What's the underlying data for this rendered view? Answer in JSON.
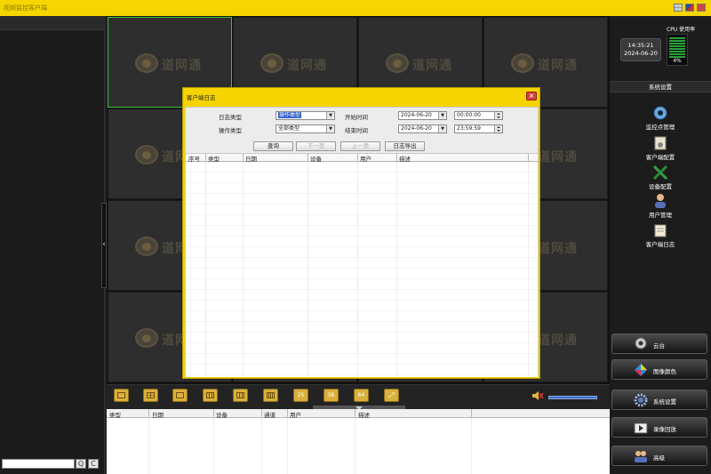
{
  "window": {
    "title": "视频监控客户端"
  },
  "left_panel": {
    "search_placeholder": "",
    "search_icon_label": "Q",
    "refresh_icon_label": "C"
  },
  "grid": {
    "watermark": "道网通",
    "cells": 16
  },
  "status": {
    "time": "14:35:21",
    "date": "2024-06-20",
    "cpu_label": "CPU 使用率",
    "cpu_percent": "4%"
  },
  "system_menu": {
    "header": "系统设置",
    "items": [
      {
        "label": "监控点管理",
        "icon": "camera-icon"
      },
      {
        "label": "客户端配置",
        "icon": "client-config-icon"
      },
      {
        "label": "设备配置",
        "icon": "tools-icon"
      },
      {
        "label": "用户管理",
        "icon": "user-icon"
      },
      {
        "label": "客户端日志",
        "icon": "log-icon"
      }
    ]
  },
  "side_buttons": [
    {
      "label": "云台",
      "icon": "ptz-icon"
    },
    {
      "label": "图像颜色",
      "icon": "color-icon"
    },
    {
      "label": "系统设置",
      "icon": "settings-icon"
    },
    {
      "label": "录像回放",
      "icon": "playback-icon"
    },
    {
      "label": "高级",
      "icon": "users-icon"
    }
  ],
  "toolbar": {
    "layouts": [
      "1",
      "4",
      "6",
      "9",
      "8",
      "16",
      "25",
      "36",
      "64",
      "full"
    ],
    "layout_labels": {
      "l25": "25",
      "l36": "36",
      "l64": "64"
    }
  },
  "event_log": {
    "columns": [
      "类型",
      "日期",
      "设备",
      "通道",
      "用户",
      "描述"
    ]
  },
  "dialog": {
    "title": "客户端日志",
    "filters": {
      "log_type_label": "日志类型",
      "log_type_value": "操作类型",
      "op_type_label": "操作类型",
      "op_type_value": "全部类型",
      "start_label": "开始时间",
      "start_date": "2024-06-20",
      "start_time": "00:00:00",
      "end_label": "结束时间",
      "end_date": "2024-06-20",
      "end_time": "23:59:59"
    },
    "buttons": {
      "query": "查询",
      "next": "下一页",
      "prev": "上一页",
      "export": "日志导出"
    },
    "columns": [
      "序号",
      "类型",
      "日期",
      "设备",
      "用户",
      "描述"
    ]
  },
  "colors": {
    "accent": "#f7d600",
    "panel": "#232323",
    "selected_cell": "#3cc33c"
  }
}
